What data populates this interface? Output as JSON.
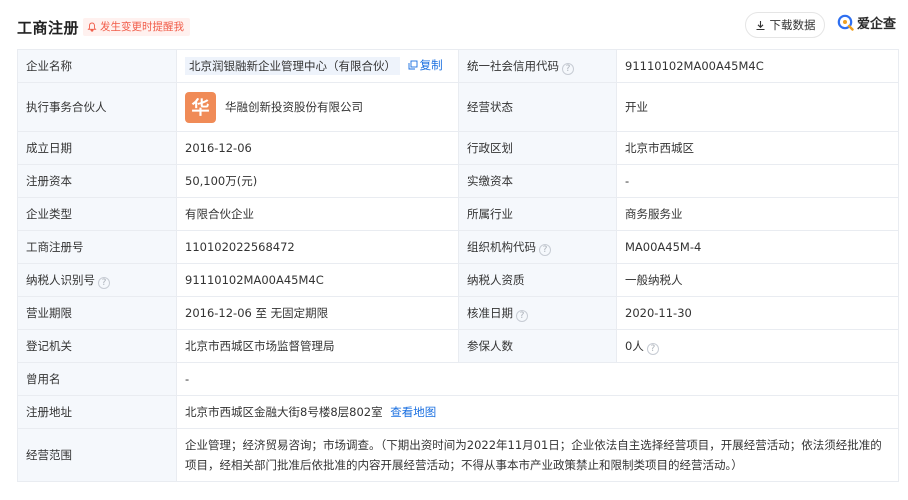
{
  "header": {
    "title": "工商注册",
    "remind_label": "发生变更时提醒我",
    "download_label": "下载数据",
    "brand_name": "爱企查"
  },
  "rows": {
    "company_name": {
      "label": "企业名称",
      "value": "北京润银融新企业管理中心（有限合伙）",
      "copy_label": "复制"
    },
    "credit_code": {
      "label": "统一社会信用代码",
      "value": "91110102MA00A45M4C"
    },
    "partner": {
      "label": "执行事务合伙人",
      "logo_char": "华",
      "value": "华融创新投资股份有限公司"
    },
    "status": {
      "label": "经营状态",
      "value": "开业"
    },
    "founded": {
      "label": "成立日期",
      "value": "2016-12-06"
    },
    "district": {
      "label": "行政区划",
      "value": "北京市西城区"
    },
    "reg_capital": {
      "label": "注册资本",
      "value": "50,100万(元)"
    },
    "paid_capital": {
      "label": "实缴资本",
      "value": "-"
    },
    "company_type": {
      "label": "企业类型",
      "value": "有限合伙企业"
    },
    "industry": {
      "label": "所属行业",
      "value": "商务服务业"
    },
    "reg_number": {
      "label": "工商注册号",
      "value": "110102022568472"
    },
    "org_code": {
      "label": "组织机构代码",
      "value": "MA00A45M-4"
    },
    "tax_id": {
      "label": "纳税人识别号",
      "value": "91110102MA00A45M4C"
    },
    "tax_qualification": {
      "label": "纳税人资质",
      "value": "一般纳税人"
    },
    "business_term": {
      "label": "营业期限",
      "value": "2016-12-06 至 无固定期限"
    },
    "approval_date": {
      "label": "核准日期",
      "value": "2020-11-30"
    },
    "authority": {
      "label": "登记机关",
      "value": "北京市西城区市场监督管理局"
    },
    "insured": {
      "label": "参保人数",
      "value": "0人"
    },
    "former_name": {
      "label": "曾用名",
      "value": "-"
    },
    "address": {
      "label": "注册地址",
      "value": "北京市西城区金融大街8号楼8层802室",
      "map_label": "查看地图"
    },
    "scope": {
      "label": "经营范围",
      "value": "企业管理；经济贸易咨询；市场调查。（下期出资时间为2022年11月01日；企业依法自主选择经营项目，开展经营活动；依法须经批准的项目，经相关部门批准后依批准的内容开展经营活动；不得从事本市产业政策禁止和限制类项目的经营活动。）"
    }
  },
  "colors": {
    "accent_blue": "#1a6fe0",
    "remind_red": "#f15d4a",
    "label_bg": "#f5f8fc",
    "partner_logo": "#f08b57"
  },
  "icons": [
    "bell-icon",
    "download-icon",
    "brand-logo-icon",
    "copy-icon",
    "help-icon"
  ]
}
